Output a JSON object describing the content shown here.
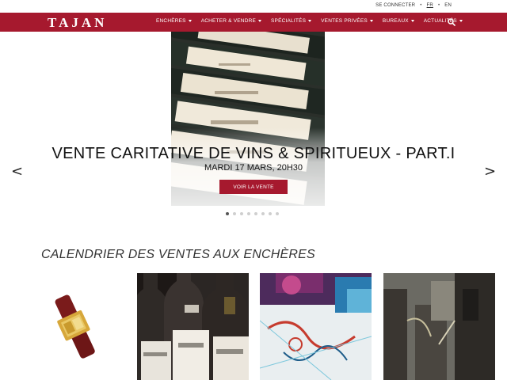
{
  "utility": {
    "login": "SE CONNECTER",
    "lang_fr": "FR",
    "lang_en": "EN",
    "sep": "•"
  },
  "header": {
    "logo": "TAJAN",
    "nav": [
      {
        "label": "ENCHÈRES"
      },
      {
        "label": "ACHETER & VENDRE"
      },
      {
        "label": "SPÉCIALITÉS"
      },
      {
        "label": "VENTES PRIVÉES"
      },
      {
        "label": "BUREAUX"
      },
      {
        "label": "ACTUALITÉS"
      }
    ],
    "search_icon": "search-icon"
  },
  "hero": {
    "title": "VENTE CARITATIVE DE VINS & SPIRITUEUX - PART.I",
    "date": "MARDI 17 MARS, 20H30",
    "cta": "VOIR LA VENTE",
    "prev": "<",
    "next": ">",
    "slides_count": 8,
    "active_slide": 1
  },
  "calendar": {
    "title": "CALENDRIER DES VENTES AUX ENCHÈRES",
    "prev": "<"
  },
  "colors": {
    "brand": "#a6192e",
    "text": "#222222"
  }
}
